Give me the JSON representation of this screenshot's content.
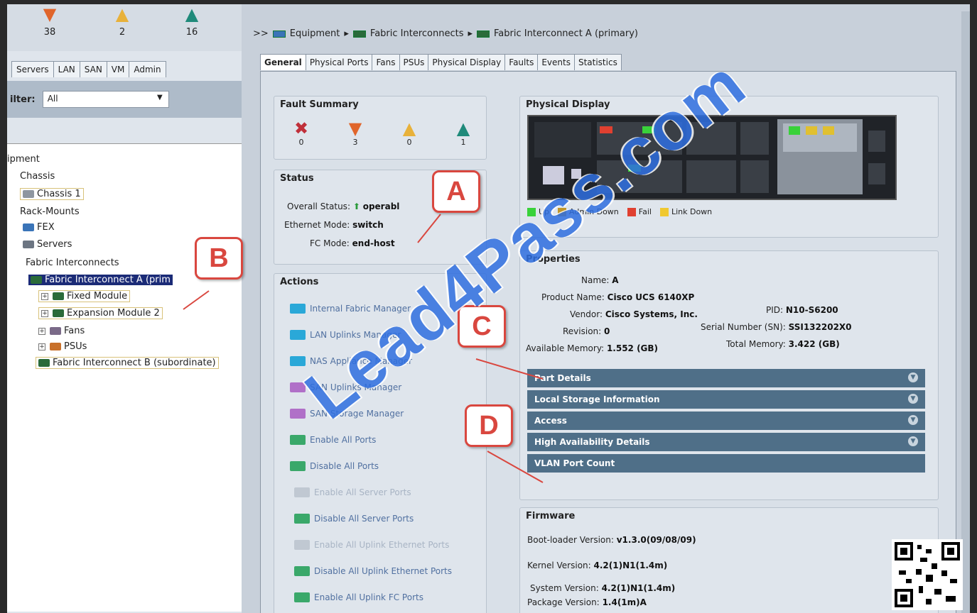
{
  "left": {
    "fault_counts": [
      {
        "icon": "major-triangle-icon",
        "glyph": "▼",
        "color": "#e0652b",
        "value": "38"
      },
      {
        "icon": "minor-triangle-icon",
        "glyph": "▲",
        "color": "#e8b13a",
        "value": "2"
      },
      {
        "icon": "warning-triangle-icon",
        "glyph": "▲",
        "color": "#1f8a7a",
        "value": "16"
      }
    ],
    "tabs": [
      "Servers",
      "LAN",
      "SAN",
      "VM",
      "Admin"
    ],
    "filter": {
      "label": "ilter:",
      "value": "All"
    },
    "tree": {
      "equipment": "ipment",
      "chassis": "Chassis",
      "chassis1": "Chassis 1",
      "rack_mounts": "Rack-Mounts",
      "fex": "FEX",
      "servers": "Servers",
      "fabric_interconnects": "Fabric Interconnects",
      "fi_a": "Fabric Interconnect A (prim",
      "fixed_module": "Fixed Module",
      "expansion_module": "Expansion Module 2",
      "fans": "Fans",
      "psus": "PSUs",
      "fi_b": "Fabric Interconnect B (subordinate)"
    }
  },
  "breadcrumb": {
    "prefix": ">>",
    "items": [
      "Equipment",
      "Fabric Interconnects",
      "Fabric Interconnect A (primary)"
    ],
    "sep": "▸"
  },
  "tabs": [
    "General",
    "Physical Ports",
    "Fans",
    "PSUs",
    "Physical Display",
    "Faults",
    "Events",
    "Statistics"
  ],
  "fault_summary": {
    "title": "Fault Summary",
    "items": [
      {
        "icon": "critical-icon",
        "glyph": "✖",
        "color": "#c0303a",
        "value": "0"
      },
      {
        "icon": "major-icon",
        "glyph": "▼",
        "color": "#e0652b",
        "value": "3"
      },
      {
        "icon": "minor-icon",
        "glyph": "▲",
        "color": "#e8b13a",
        "value": "0"
      },
      {
        "icon": "warning-icon",
        "glyph": "▲",
        "color": "#1f8a7a",
        "value": "1"
      }
    ]
  },
  "status": {
    "title": "Status",
    "overall_label": "Overall Status:",
    "overall_value": "operabl",
    "eth_label": "Ethernet Mode:",
    "eth_value": "switch",
    "fc_label": "FC Mode:",
    "fc_value": "end-host"
  },
  "actions": {
    "title": "Actions",
    "items": [
      {
        "label": "Internal Fabric Manager",
        "color": "#2aa8d8",
        "dim": false
      },
      {
        "label": "LAN Uplinks Manager",
        "color": "#2aa8d8",
        "dim": false
      },
      {
        "label": "NAS Appliance Manager",
        "color": "#2aa8d8",
        "dim": false
      },
      {
        "label": "SAN Uplinks Manager",
        "color": "#b070c8",
        "dim": false
      },
      {
        "label": "SAN Storage Manager",
        "color": "#b070c8",
        "dim": false
      },
      {
        "label": "Enable All Ports",
        "color": "#3aa86a",
        "dim": false
      },
      {
        "label": "Disable All Ports",
        "color": "#3aa86a",
        "dim": false
      },
      {
        "label": "Enable All Server Ports",
        "color": "#c0c8d2",
        "dim": true
      },
      {
        "label": "Disable All Server Ports",
        "color": "#3aa86a",
        "dim": false
      },
      {
        "label": "Enable All Uplink Ethernet Ports",
        "color": "#c0c8d2",
        "dim": true
      },
      {
        "label": "Disable All Uplink Ethernet Ports",
        "color": "#3aa86a",
        "dim": false
      },
      {
        "label": "Enable All Uplink FC Ports",
        "color": "#3aa86a",
        "dim": false
      }
    ]
  },
  "physical_display": {
    "title": "Physical Display",
    "legend": [
      {
        "label": "Up",
        "color": "#39d23a"
      },
      {
        "label": "Admin Down",
        "color": "#c0962a"
      },
      {
        "label": "Fail",
        "color": "#e04030"
      },
      {
        "label": "Link Down",
        "color": "#f0c830"
      }
    ]
  },
  "properties": {
    "title": "Properties",
    "name_label": "Name:",
    "name_value": "A",
    "product_label": "Product Name:",
    "product_value": "Cisco UCS 6140XP",
    "vendor_label": "Vendor:",
    "vendor_value": "Cisco Systems, Inc.",
    "pid_label": "PID:",
    "pid_value": "N10-S6200",
    "revision_label": "Revision:",
    "revision_value": "0",
    "serial_label": "Serial Number (SN):",
    "serial_value": "SSI132202X0",
    "avail_mem_label": "Available Memory:",
    "avail_mem_value": "1.552 (GB)",
    "total_mem_label": "Total Memory:",
    "total_mem_value": "3.422 (GB)"
  },
  "sections": [
    "Part Details",
    "Local Storage Information",
    "Access",
    "High Availability Details",
    "VLAN Port Count"
  ],
  "firmware": {
    "title": "Firmware",
    "boot_label": "Boot-loader Version:",
    "boot_value": "v1.3.0(09/08/09)",
    "kernel_label": "Kernel Version:",
    "kernel_value": "4.2(1)N1(1.4m)",
    "system_label": "System Version:",
    "system_value": "4.2(1)N1(1.4m)",
    "package_label": "Package Version:",
    "package_value": "1.4(1m)A"
  },
  "callouts": [
    "A",
    "B",
    "C",
    "D"
  ],
  "watermark": "Lead4Pass.com"
}
